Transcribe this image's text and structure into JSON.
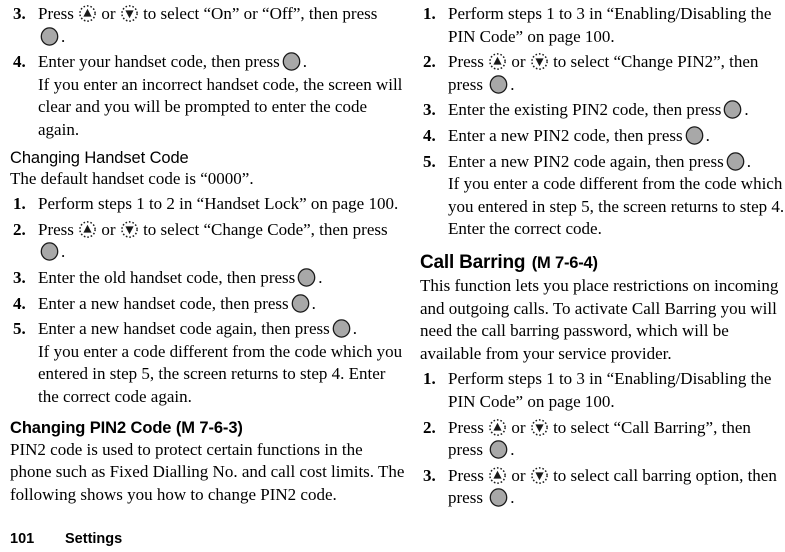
{
  "footer": {
    "page_number": "101",
    "section": "Settings"
  },
  "icons": {
    "nav_up": "nav-up-icon",
    "nav_down": "nav-down-icon",
    "ok_button": "ok-button-icon"
  },
  "colors": {
    "text": "#000000",
    "page_background": "#ffffff",
    "key_fill": "#a8a8a8",
    "key_outline": "#1a1a1a"
  },
  "left_column": {
    "step3": {
      "num": "3.",
      "text_before_up": "Press",
      "text_between": "or",
      "text_after_down": "to select “On” or “Off”, then press",
      "text_end": "."
    },
    "step4": {
      "num": "4.",
      "text": "Enter your handset code, then press",
      "text_end": ".",
      "sub": "If you enter an incorrect handset code, the screen will clear and you will be prompted to enter the code again."
    },
    "heading_changing_handset_code": "Changing Handset Code",
    "intro_default_code": "The default handset code is “0000”.",
    "step1": {
      "num": "1.",
      "text": "Perform steps 1 to 2 in “Handset Lock” on page 100."
    },
    "step2": {
      "num": "2.",
      "text_before_up": "Press",
      "text_between": "or",
      "text_after_down": "to select “Change Code”, then press",
      "text_end": "."
    },
    "step3b": {
      "num": "3.",
      "text": "Enter the old handset code, then press",
      "text_end": "."
    },
    "step4b": {
      "num": "4.",
      "text": "Enter a new handset code, then press",
      "text_end": "."
    },
    "step5b": {
      "num": "5.",
      "text": "Enter a new handset code again, then press",
      "text_end": ".",
      "sub": "If you enter a code different from the code which you entered in step 5, the screen returns to step 4. Enter the correct code again."
    },
    "heading_changing_pin2_code": "Changing PIN2 Code (M 7-6-3)",
    "pin2_description": "PIN2 code is used to protect certain functions in the phone such as Fixed Dialling No. and call cost limits. The following shows you how to change PIN2 code."
  },
  "right_column": {
    "step1": {
      "num": "1.",
      "text": "Perform steps 1 to 3 in “Enabling/Disabling the PIN Code” on page 100."
    },
    "step2": {
      "num": "2.",
      "text_before_up": "Press",
      "text_between": "or",
      "text_after_down": "to select “Change PIN2”, then press",
      "text_end": "."
    },
    "step3": {
      "num": "3.",
      "text": "Enter the existing PIN2 code, then press",
      "text_end": "."
    },
    "step4": {
      "num": "4.",
      "text": "Enter a new PIN2 code, then press",
      "text_end": "."
    },
    "step5": {
      "num": "5.",
      "text": "Enter a new PIN2 code again, then press",
      "text_end": ".",
      "sub": "If you enter a code different from the code which you entered in step 5, the screen returns to step 4. Enter the correct code."
    },
    "heading_call_barring_main": "Call Barring",
    "heading_call_barring_code": "(M 7-6-4)",
    "call_barring_description": "This function lets you place restrictions on incoming and outgoing calls. To activate Call Barring you will need the call barring password, which will be available from your service provider.",
    "cb_step1": {
      "num": "1.",
      "text": "Perform steps 1 to 3 in “Enabling/Disabling the PIN Code” on page 100."
    },
    "cb_step2": {
      "num": "2.",
      "text_before_up": "Press",
      "text_between": "or",
      "text_after_down": "to select “Call Barring”, then press",
      "text_end": "."
    },
    "cb_step3": {
      "num": "3.",
      "text_before_up": "Press",
      "text_between": "or",
      "text_after_down": "to select call barring option, then press",
      "text_end": "."
    }
  }
}
